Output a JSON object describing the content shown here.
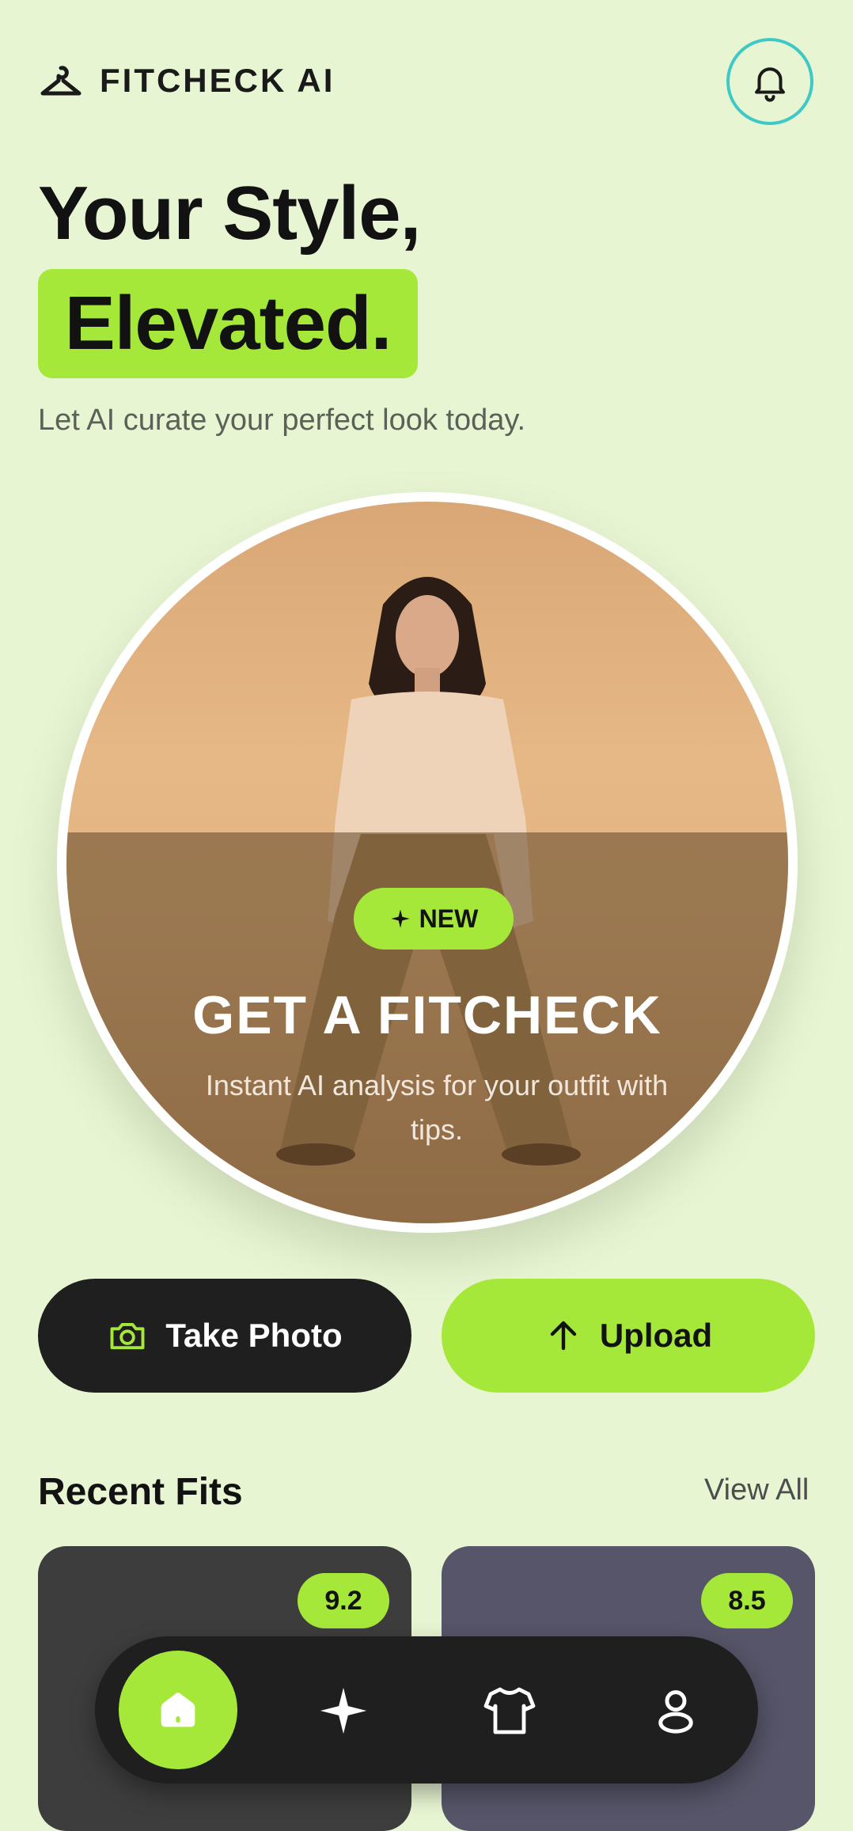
{
  "header": {
    "brand": "FITCHECK AI",
    "logo_icon": "hanger-icon",
    "notification_icon": "bell-icon"
  },
  "hero": {
    "line1": "Your Style,",
    "line2": "Elevated.",
    "subtitle": "Let AI curate your perfect look today."
  },
  "feature_card": {
    "badge": "NEW",
    "badge_icon": "sparkle-icon",
    "title": "GET A FITCHECK",
    "description": "Instant AI analysis for your outfit with tips."
  },
  "actions": {
    "take_photo": "Take Photo",
    "take_photo_icon": "camera-icon",
    "upload": "Upload",
    "upload_icon": "arrow-up-icon"
  },
  "recent": {
    "title": "Recent Fits",
    "view_all": "View All",
    "items": [
      {
        "score": "9.2"
      },
      {
        "score": "8.5"
      }
    ]
  },
  "nav": {
    "items": [
      "home-icon",
      "sparkle-icon",
      "tshirt-icon",
      "profile-icon"
    ],
    "active": "home"
  },
  "colors": {
    "background": "#e8f5d3",
    "accent": "#a6e83a",
    "dark": "#1f1f1f",
    "bell_ring": "#3ec9c6"
  }
}
